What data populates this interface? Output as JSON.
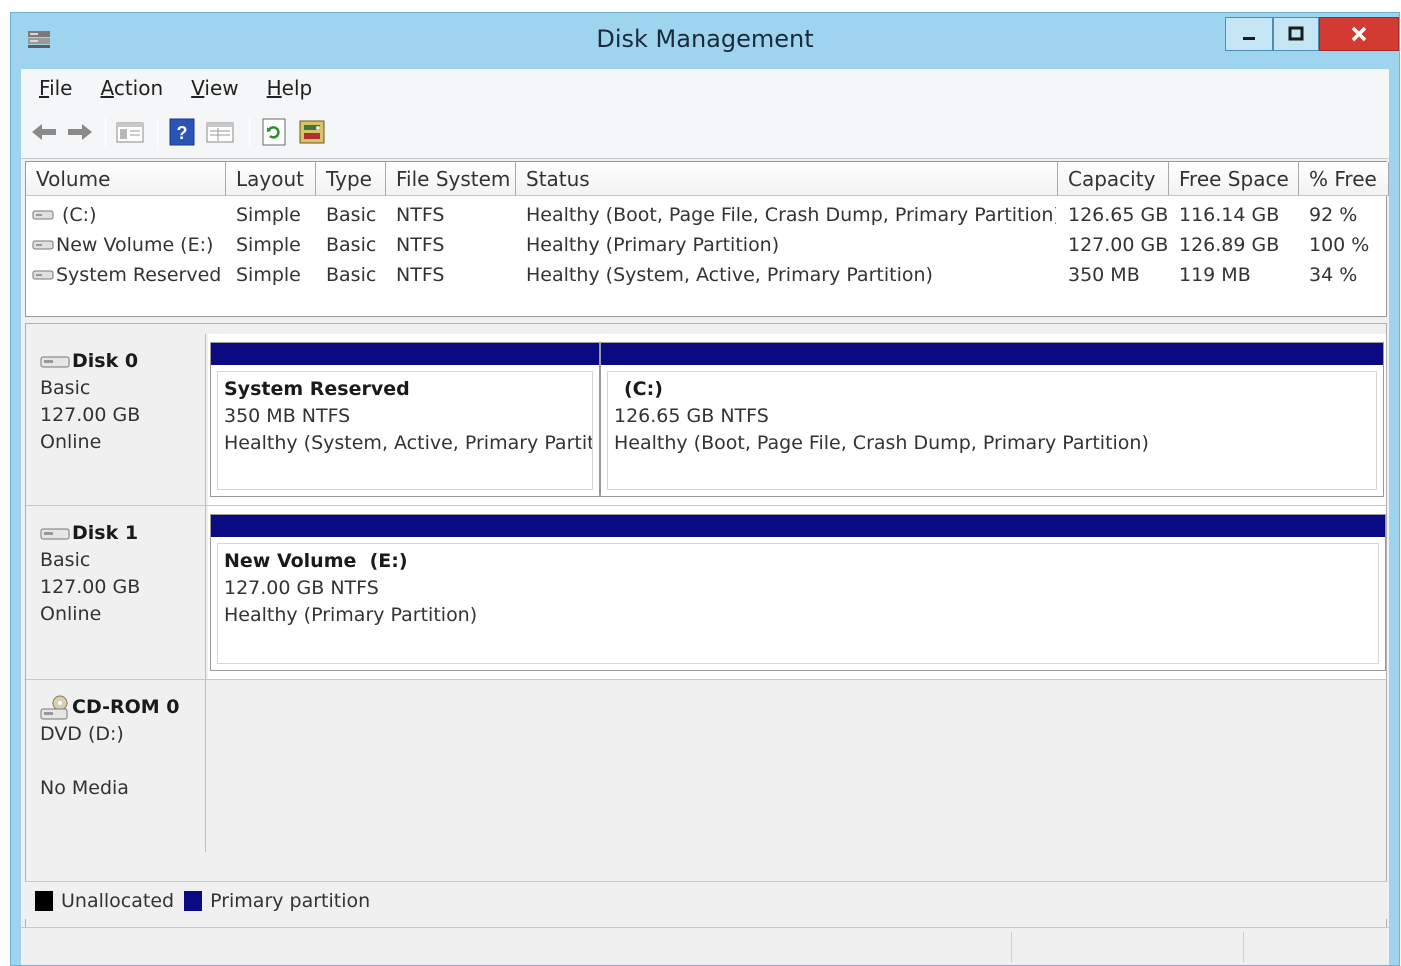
{
  "window": {
    "title": "Disk Management"
  },
  "menu": [
    {
      "label": "File",
      "key": "F",
      "rest": "ile"
    },
    {
      "label": "Action",
      "key": "A",
      "rest": "ction"
    },
    {
      "label": "View",
      "key": "V",
      "rest": "iew"
    },
    {
      "label": "Help",
      "key": "H",
      "rest": "elp"
    }
  ],
  "toolbar": [
    "back-icon",
    "forward-icon",
    "show-hide-console-tree-icon",
    "help-icon",
    "properties-icon",
    "refresh-icon",
    "disk-wizard-icon"
  ],
  "volume_table": {
    "columns": [
      "Volume",
      "Layout",
      "Type",
      "File System",
      "Status",
      "Capacity",
      "Free Space",
      "% Free"
    ],
    "rows": [
      [
        "(C:)",
        "Simple",
        "Basic",
        "NTFS",
        "Healthy (Boot, Page File, Crash Dump, Primary Partition)",
        "126.65 GB",
        "116.14 GB",
        "92 %"
      ],
      [
        "New Volume (E:)",
        "Simple",
        "Basic",
        "NTFS",
        "Healthy (Primary Partition)",
        "127.00 GB",
        "126.89 GB",
        "100 %"
      ],
      [
        "System Reserved",
        "Simple",
        "Basic",
        "NTFS",
        "Healthy (System, Active, Primary Partition)",
        "350 MB",
        "119 MB",
        "34 %"
      ]
    ]
  },
  "disks": [
    {
      "name": "Disk 0",
      "type": "Basic",
      "size": "127.00 GB",
      "state": "Online",
      "partitions": [
        {
          "name": "System Reserved",
          "size": "350 MB NTFS",
          "status": "Healthy (System, Active, Primary Partiti"
        },
        {
          "name": "(C:)",
          "size": "126.65 GB NTFS",
          "status": "Healthy (Boot, Page File, Crash Dump, Primary Partition)"
        }
      ]
    },
    {
      "name": "Disk 1",
      "type": "Basic",
      "size": "127.00 GB",
      "state": "Online",
      "partitions": [
        {
          "name": "New Volume  (E:)",
          "size": "127.00 GB NTFS",
          "status": "Healthy (Primary Partition)"
        }
      ]
    }
  ],
  "cdrom": {
    "name": "CD-ROM 0",
    "drive": "DVD (D:)",
    "media": "No Media"
  },
  "legend": [
    {
      "label": "Unallocated",
      "color": "#000000"
    },
    {
      "label": "Primary partition",
      "color": "#0a0a82"
    }
  ]
}
